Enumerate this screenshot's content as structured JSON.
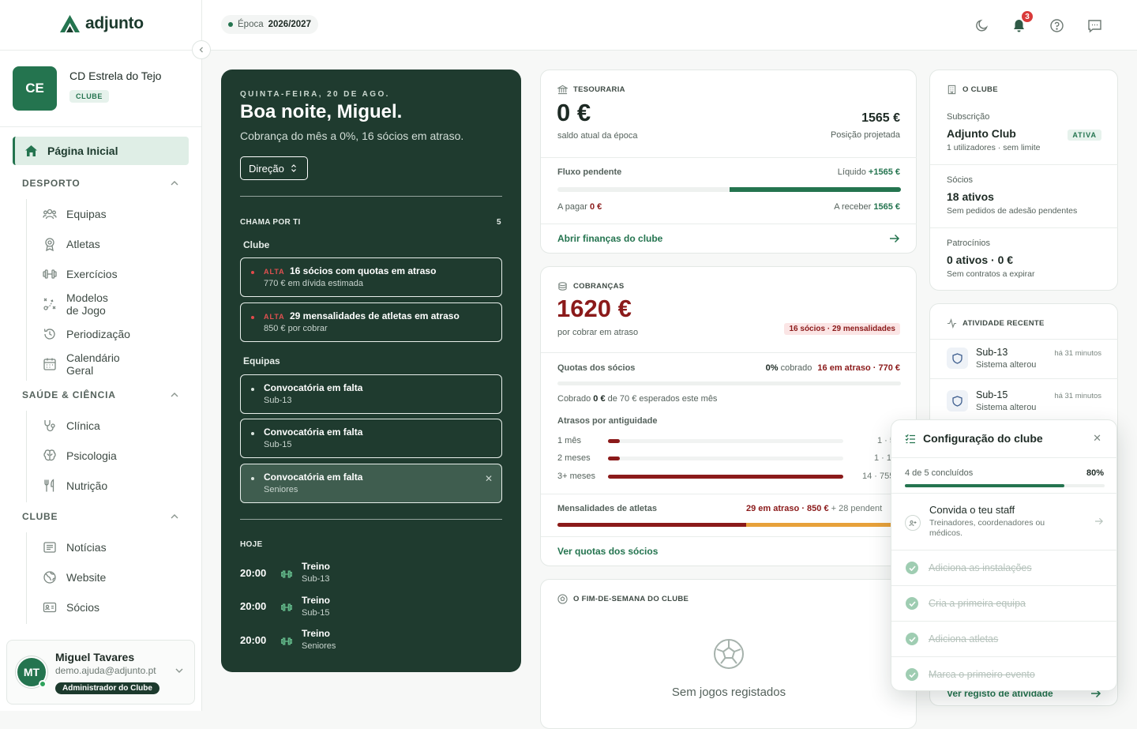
{
  "brand": {
    "name": "adjunto"
  },
  "club": {
    "initials": "CE",
    "name": "CD Estrela do Tejo",
    "badge": "CLUBE"
  },
  "nav": {
    "home": "Página Inicial",
    "sections": [
      {
        "title": "DESPORTO",
        "items": [
          "Equipas",
          "Atletas",
          "Exercícios",
          "Modelos de Jogo",
          "Periodização",
          "Calendário Geral"
        ]
      },
      {
        "title": "SAÚDE & CIÊNCIA",
        "items": [
          "Clínica",
          "Psicologia",
          "Nutrição"
        ]
      },
      {
        "title": "CLUBE",
        "items": [
          "Notícias",
          "Website",
          "Sócios"
        ]
      }
    ]
  },
  "user": {
    "initials": "MT",
    "name": "Miguel Tavares",
    "email": "demo.ajuda@adjunto.pt",
    "role": "Administrador do Clube"
  },
  "topbar": {
    "season_label": "Época",
    "season_value": "2026/2027",
    "notifications": "3"
  },
  "hero": {
    "date": "QUINTA-FEIRA, 20 DE AGO.",
    "greeting": "Boa noite, Miguel.",
    "subtitle": "Cobrança do mês a 0%, 16 sócios em atraso.",
    "role_select": "Direção",
    "attention_label": "CHAMA POR TI",
    "attention_count": "5",
    "group_club": "Clube",
    "group_teams": "Equipas",
    "alerts_club": [
      {
        "level": "ALTA",
        "title": "16 sócios com quotas em atraso",
        "detail": "770 € em dívida estimada"
      },
      {
        "level": "ALTA",
        "title": "29 mensalidades de atletas em atraso",
        "detail": "850 € por cobrar"
      }
    ],
    "alerts_teams": [
      {
        "title": "Convocatória em falta",
        "detail": "Sub-13"
      },
      {
        "title": "Convocatória em falta",
        "detail": "Sub-15"
      },
      {
        "title": "Convocatória em falta",
        "detail": "Seniores"
      }
    ],
    "today_label": "HOJE",
    "schedule": [
      {
        "time": "20:00",
        "title": "Treino",
        "team": "Sub-13"
      },
      {
        "time": "20:00",
        "title": "Treino",
        "team": "Sub-15"
      },
      {
        "time": "20:00",
        "title": "Treino",
        "team": "Seniores"
      }
    ]
  },
  "treasury": {
    "title": "TESOURARIA",
    "balance": "0 €",
    "balance_label": "saldo atual da época",
    "projected": "1565 €",
    "projected_label": "Posição projetada",
    "flow_label": "Fluxo pendente",
    "net_label": "Líquido",
    "net_value": "+1565 €",
    "pay_label": "A pagar",
    "pay_value": "0 €",
    "receive_label": "A receber",
    "receive_value": "1565 €",
    "receive_share": 0.5,
    "link": "Abrir finanças do clube"
  },
  "collections": {
    "title": "COBRANÇAS",
    "amount": "1620 €",
    "amount_label": "por cobrar em atraso",
    "tag": "16 sócios · 29 mensalidades",
    "fees_label": "Quotas dos sócios",
    "fees_pct": "0%",
    "fees_collected_word": "cobrado",
    "fees_overdue": "16 em atraso · 770 €",
    "collected_prefix": "Cobrado",
    "collected_value": "0 €",
    "collected_suffix": "de 70 € esperados este mês",
    "aging_label": "Atrasos por antiguidade",
    "aging": [
      {
        "label": "1 mês",
        "value": "1 · 5",
        "share": 0.05
      },
      {
        "label": "2 meses",
        "value": "1 · 10",
        "share": 0.05
      },
      {
        "label": "3+ meses",
        "value": "14 · 755",
        "share": 1.0
      }
    ],
    "monthly_label": "Mensalidades de atletas",
    "monthly_overdue": "29 em atraso · 850 €",
    "monthly_pending": "+ 28 pendent",
    "monthly_overdue_share": 0.55,
    "link": "Ver quotas dos sócios"
  },
  "weekend": {
    "title": "O FIM-DE-SEMANA DO CLUBE",
    "empty": "Sem jogos registados"
  },
  "club_panel": {
    "title": "O CLUBE",
    "subscription_label": "Subscrição",
    "plan": "Adjunto Club",
    "plan_status": "ATIVA",
    "plan_detail": "1 utilizadores · sem limite",
    "members_label": "Sócios",
    "members_value": "18 ativos",
    "members_detail": "Sem pedidos de adesão pendentes",
    "sponsors_label": "Patrocínios",
    "sponsors_value": "0 ativos · 0 €",
    "sponsors_detail": "Sem contratos a expirar"
  },
  "activity": {
    "title": "ATIVIDADE RECENTE",
    "items": [
      {
        "team": "Sub-13",
        "time": "há 31 minutos",
        "detail": "Sistema alterou"
      },
      {
        "team": "Sub-15",
        "time": "há 31 minutos",
        "detail": "Sistema alterou"
      }
    ],
    "link": "Ver registo de atividade"
  },
  "setup": {
    "title": "Configuração do clube",
    "progress_text": "4 de 5 concluídos",
    "progress_pct": "80%",
    "progress": 0.8,
    "next_title": "Convida o teu staff",
    "next_detail": "Treinadores, coordenadores ou médicos.",
    "done": [
      "Adiciona as instalações",
      "Cria a primeira equipa",
      "Adiciona atletas",
      "Marca o primeiro evento"
    ]
  },
  "colors": {
    "brand": "#24744f",
    "dark": "#1f3b2f",
    "danger": "#8b1a1a",
    "warning": "#e8a13a"
  }
}
